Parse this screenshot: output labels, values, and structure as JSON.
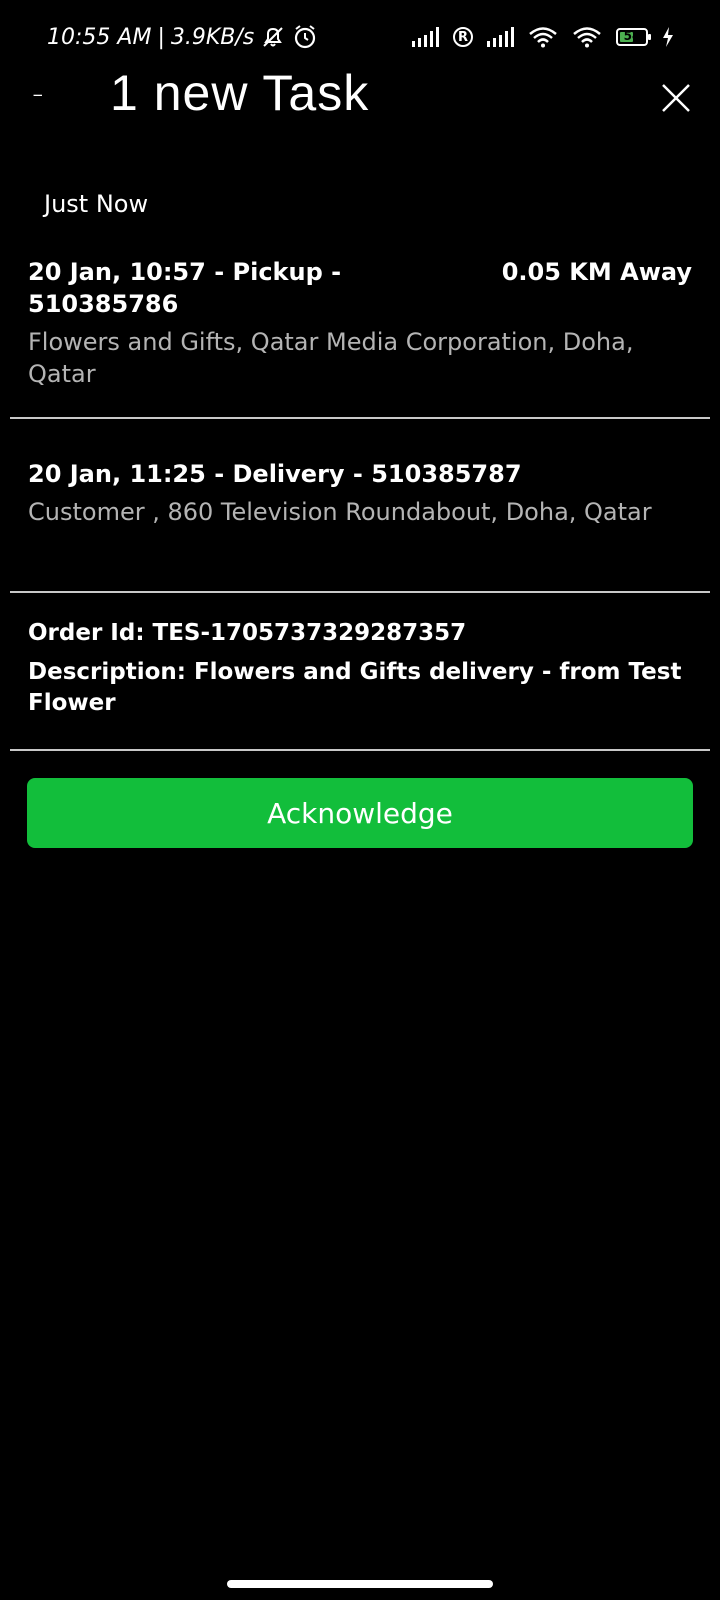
{
  "status_bar": {
    "time": "10:55 AM",
    "network_speed": "3.9KB/s",
    "battery_level": "54",
    "battery_fraction": 0.54,
    "icons": [
      "mute-icon",
      "alarm-icon",
      "signal-icon",
      "roaming-icon",
      "signal-icon",
      "wifi-icon",
      "wifi-icon",
      "battery-icon",
      "charging-icon"
    ]
  },
  "header": {
    "menu_glyph": "-",
    "title": "1 new Task",
    "close_icon": "close-icon"
  },
  "section_label": "Just Now",
  "tasks": [
    {
      "heading_line1": "20 Jan, 10:57 - Pickup -",
      "heading_line2": "510385786",
      "distance": "0.05 KM Away",
      "address": "Flowers and Gifts, Qatar Media Corporation, Doha, Qatar"
    },
    {
      "heading_line1": "20 Jan, 11:25 - Delivery - 510385787",
      "address": "Customer , 860 Television Roundabout, Doha, Qatar"
    }
  ],
  "order": {
    "order_id": "Order Id: TES-1705737329287357",
    "description": "Description: Flowers and Gifts delivery - from Test Flower"
  },
  "actions": {
    "acknowledge_label": "Acknowledge"
  },
  "colors": {
    "background": "#000000",
    "accent": "#12be3b",
    "secondary_text": "#b4b4b4"
  }
}
